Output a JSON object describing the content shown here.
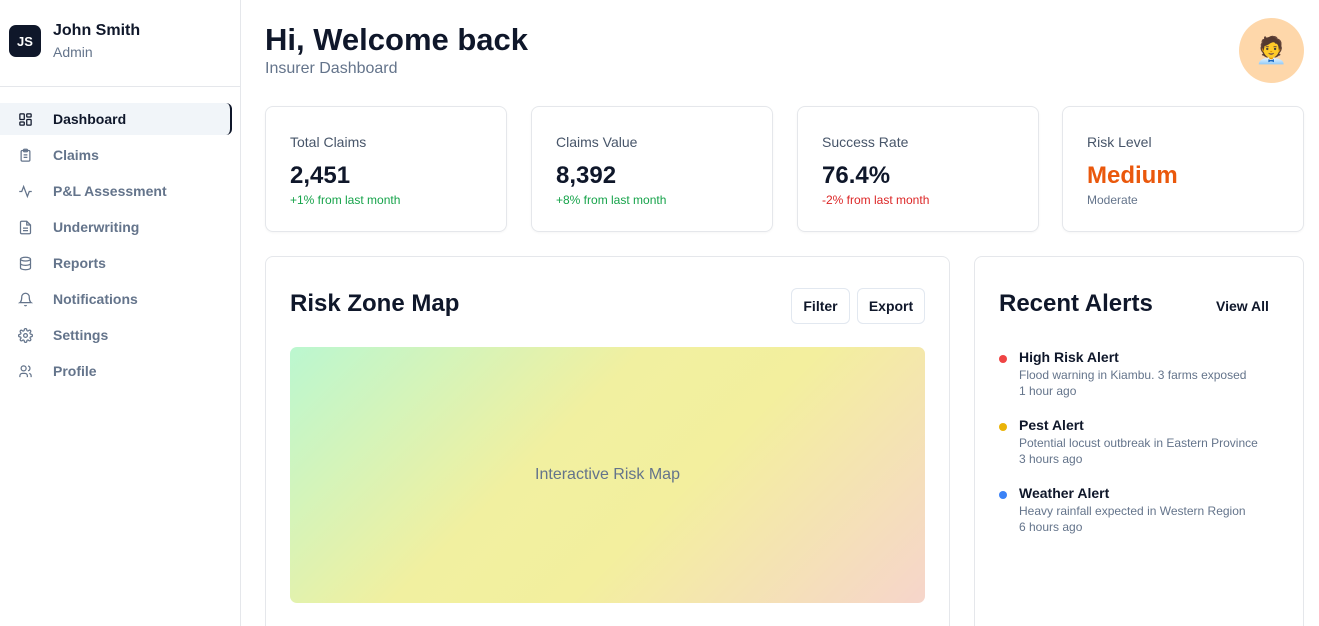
{
  "user": {
    "initials": "JS",
    "name": "John Smith",
    "role": "Admin"
  },
  "nav": [
    {
      "label": "Dashboard",
      "icon": "dashboard-grid-icon",
      "active": true
    },
    {
      "label": "Claims",
      "icon": "clipboard-icon"
    },
    {
      "label": "P&L Assessment",
      "icon": "activity-icon"
    },
    {
      "label": "Underwriting",
      "icon": "document-icon"
    },
    {
      "label": "Reports",
      "icon": "database-icon"
    },
    {
      "label": "Notifications",
      "icon": "bell-icon"
    },
    {
      "label": "Settings",
      "icon": "gear-icon"
    },
    {
      "label": "Profile",
      "icon": "users-icon"
    }
  ],
  "header": {
    "greeting": "Hi, Welcome back",
    "subtitle": "Insurer Dashboard",
    "profile_emoji": "🧑‍💼"
  },
  "stats": [
    {
      "title": "Total Claims",
      "value": "2,451",
      "delta": "+1% from last month"
    },
    {
      "title": "Claims Value",
      "value": "8,392",
      "delta": "+8% from last month"
    },
    {
      "title": "Success Rate",
      "value": "76.4%",
      "delta": "-2% from last month"
    },
    {
      "title": "Risk Level",
      "value": "Medium",
      "delta": "Moderate"
    }
  ],
  "map": {
    "title": "Risk Zone Map",
    "filter_label": "Filter",
    "export_label": "Export",
    "placeholder": "Interactive Risk Map"
  },
  "alerts": {
    "title": "Recent Alerts",
    "view_all": "View All",
    "items": [
      {
        "title": "High Risk Alert",
        "desc": "Flood warning in Kiambu. 3 farms exposed",
        "time": "1 hour ago",
        "color": "#ef4444"
      },
      {
        "title": "Pest Alert",
        "desc": "Potential locust outbreak in Eastern Province",
        "time": "3 hours ago",
        "color": "#eab308"
      },
      {
        "title": "Weather Alert",
        "desc": "Heavy rainfall expected in Western Region",
        "time": "6 hours ago",
        "color": "#3b82f6"
      }
    ]
  },
  "colors": {
    "accent": "#0f172a",
    "risk_medium": "#ea580c",
    "positive": "#16a34a",
    "negative": "#dc2626"
  }
}
